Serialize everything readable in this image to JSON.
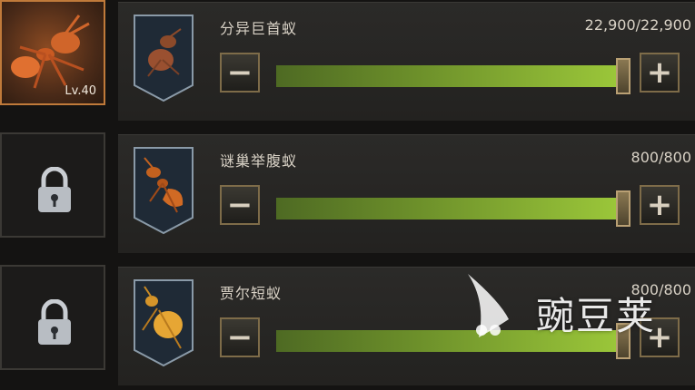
{
  "colors": {
    "fill_start": "#4e6a23",
    "fill_end": "#9cc83a",
    "frame_gold": "#7e6c49"
  },
  "rows": [
    {
      "name": "分异巨首蚁",
      "count": "22,900/22,900",
      "level": "Lv.40",
      "locked": false,
      "fill": 1.0,
      "slot_icon": "ant-unit-icon",
      "card_icon": "ant-card-icon"
    },
    {
      "name": "谜巢举腹蚁",
      "count": "800/800",
      "level": "",
      "locked": true,
      "fill": 1.0,
      "slot_icon": "lock-icon",
      "card_icon": "ant-card-icon"
    },
    {
      "name": "贾尔短蚁",
      "count": "800/800",
      "level": "",
      "locked": true,
      "fill": 1.0,
      "slot_icon": "lock-icon",
      "card_icon": "ant-card-icon"
    }
  ],
  "buttons": {
    "minus": "−",
    "plus": "+"
  },
  "watermark": {
    "text": "豌豆荚"
  }
}
